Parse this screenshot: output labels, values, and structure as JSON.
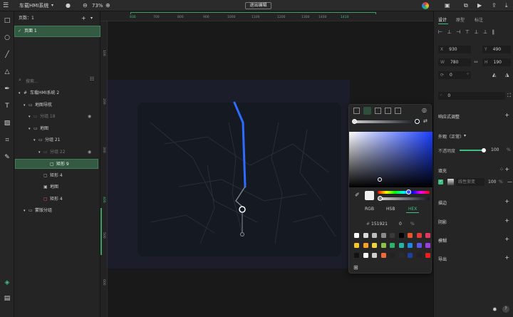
{
  "topbar": {
    "app_title": "车载HMI系统",
    "zoom": "73%",
    "center_button": "退出编辑"
  },
  "layers": {
    "pages_header": "页数：1",
    "pages": [
      {
        "label": "页面 1",
        "selected": true
      }
    ],
    "search_placeholder": "搜索...",
    "tree": [
      {
        "label": "车载HMI系统 2",
        "level": 0,
        "icon": "frame-icon",
        "muted": false
      },
      {
        "label": "地图导航",
        "level": 1,
        "icon": "folder-icon",
        "muted": false
      },
      {
        "label": "分组 18",
        "level": 2,
        "icon": "folder-icon",
        "muted": true
      },
      {
        "label": "地图",
        "level": 2,
        "icon": "folder-icon",
        "muted": false
      },
      {
        "label": "分组 21",
        "level": 3,
        "icon": "folder-icon",
        "muted": false
      },
      {
        "label": "分组 22",
        "level": 4,
        "icon": "folder-icon",
        "muted": true
      },
      {
        "label": "矩形 9",
        "level": 5,
        "icon": "rect-icon",
        "muted": false,
        "selected": true
      },
      {
        "label": "矩形 4",
        "level": 4,
        "icon": "rect-icon",
        "muted": false
      },
      {
        "label": "地图",
        "level": 4,
        "icon": "image-icon",
        "muted": false
      },
      {
        "label": "矩形 4",
        "level": 4,
        "icon": "rect-icon",
        "muted": false
      },
      {
        "label": "蒙版分组",
        "level": 1,
        "icon": "folder-icon",
        "muted": false
      }
    ]
  },
  "ruler_top": [
    "600",
    "700",
    "800",
    "900",
    "1000",
    "1100",
    "1200",
    "1300",
    "1400"
  ],
  "ruler_top_highlight": [
    "930",
    "1410"
  ],
  "ruler_left": [
    "100",
    "200",
    "300",
    "400",
    "500",
    "600"
  ],
  "inspector": {
    "tabs": [
      "设计",
      "原型",
      "标注"
    ],
    "x": "930",
    "y": "490",
    "w": "780",
    "h": "190",
    "rotation": "0",
    "rotation_unit": "°",
    "corner_radius": "0",
    "responsive": "响应式调整",
    "appearance": "外观（正常）",
    "opacity_label": "不透明度",
    "opacity_value": "100",
    "opacity_unit": "%",
    "fill_label": "填充",
    "fill_name": "线性渐变",
    "fill_opacity": "100",
    "fill_unit": "%",
    "stroke_label": "描边",
    "shadow_label": "阴影",
    "blur_label": "模糊",
    "export_label": "导出"
  },
  "picker": {
    "modes": [
      "RGB",
      "HSB",
      "HEX"
    ],
    "active_mode": "HEX",
    "hex_prefix": "#",
    "hex_value": "151921",
    "alpha": "0",
    "alpha_unit": "%",
    "swatches_row1": [
      "#ffffff",
      "#d9d9d9",
      "#bdbdbd",
      "#8a8a8a",
      "#3a3a3a",
      "#000000",
      "#e8562a",
      "#e53935",
      "#e8375f"
    ],
    "swatches_row2": [
      "#f5c52b",
      "#f59f2a",
      "#f0d23a",
      "#8bc34a",
      "#2ab36a",
      "#1fb9a0",
      "#1e88e5",
      "#5b56e8",
      "#9c3fe0"
    ],
    "swatches_row3": [
      "#111111",
      "#ffffff",
      "#cfcfcf",
      "#f06a3a",
      "#222222",
      "#2a2a2a",
      "#1c3fa0",
      "#222222",
      "#e62020"
    ]
  }
}
